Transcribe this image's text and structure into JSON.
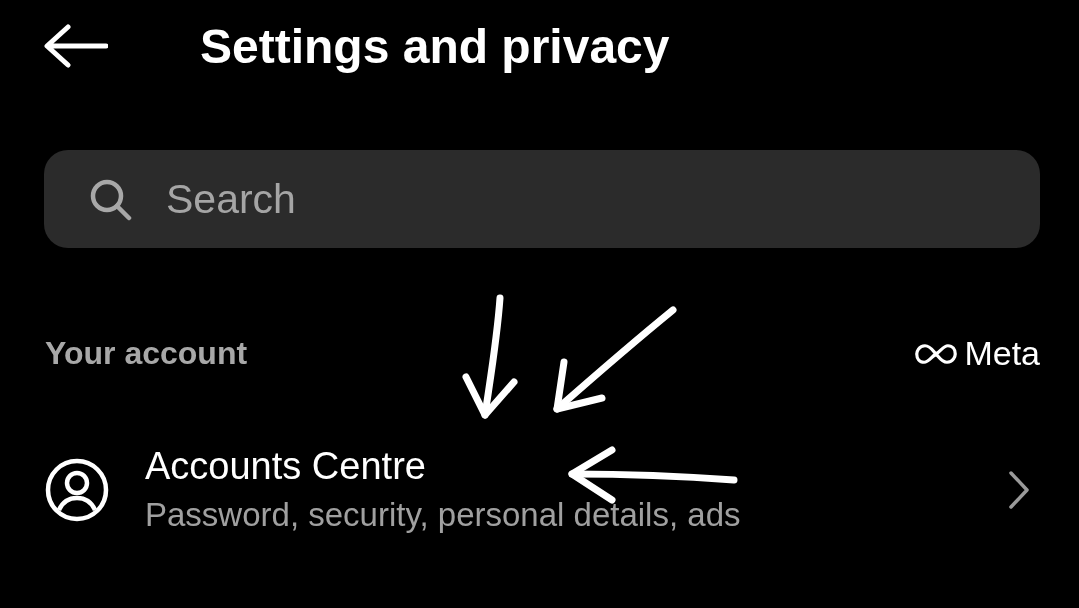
{
  "header": {
    "title": "Settings and privacy"
  },
  "search": {
    "placeholder": "Search"
  },
  "section": {
    "label": "Your account",
    "brand": "Meta"
  },
  "items": [
    {
      "title": "Accounts Centre",
      "subtitle": "Password, security, personal details, ads"
    }
  ]
}
